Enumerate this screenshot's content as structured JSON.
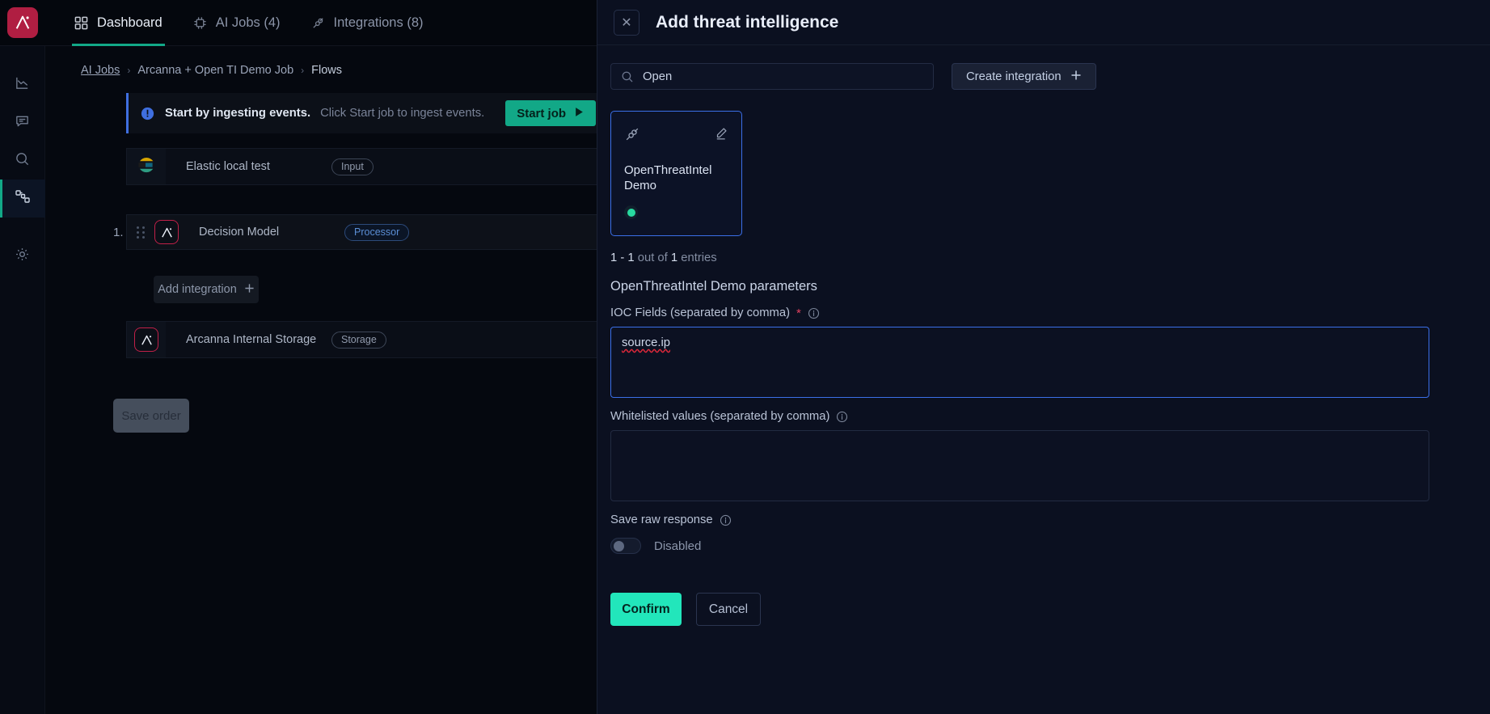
{
  "app": {
    "brand_color": "#b01e42",
    "accent_teal": "#12a887",
    "accent_cyan": "#22e6bb",
    "nav": [
      {
        "label": "Dashboard",
        "icon": "grid-icon",
        "active": true
      },
      {
        "label": "AI Jobs (4)",
        "icon": "chip-icon",
        "active": false
      },
      {
        "label": "Integrations (8)",
        "icon": "plug-icon",
        "active": false
      }
    ],
    "sidebar": [
      {
        "name": "analytics",
        "icon": "chart-line-icon",
        "active": false
      },
      {
        "name": "feedback",
        "icon": "comment-icon",
        "active": false
      },
      {
        "name": "search",
        "icon": "search-icon",
        "active": false
      },
      {
        "name": "flows",
        "icon": "nodes-icon",
        "active": true
      },
      {
        "name": "settings",
        "icon": "gear-icon",
        "active": false
      }
    ],
    "breadcrumb": {
      "first": "AI Jobs",
      "second": "Arcanna + Open TI Demo Job",
      "third": "Flows",
      "separator": "›"
    },
    "notice": {
      "icon": "info-circle-icon",
      "strong": "Start by ingesting events.",
      "sub": "Click Start job to ingest events.",
      "button": "Start job",
      "button_icon": "play-icon"
    },
    "flow": {
      "input_row": {
        "name": "Elastic local test",
        "badge": "Input",
        "icon": "elastic-icon"
      },
      "step_number": "1.",
      "processor_row": {
        "name": "Decision Model",
        "badge": "Processor",
        "icon": "arcanna-icon",
        "grip": "drag-handle-icon"
      },
      "add_integration": "Add integration",
      "add_integration_icon": "plus-icon",
      "storage_row": {
        "name": "Arcanna Internal Storage",
        "badge": "Storage",
        "icon": "arcanna-icon"
      },
      "save_order": "Save order"
    }
  },
  "drawer": {
    "title": "Add threat intelligence",
    "close_icon": "close-icon",
    "search": {
      "value": "Open",
      "placeholder": "Search",
      "icon": "search-icon"
    },
    "create_button": {
      "label": "Create integration",
      "icon": "plus-icon"
    },
    "card": {
      "title": "OpenThreatIntel Demo",
      "icon": "plug-icon",
      "edit_icon": "pencil-icon",
      "status": "online",
      "status_color": "#28d9a0",
      "selected": true
    },
    "entries": {
      "range": "1 - 1",
      "middle": "out of",
      "total": "1",
      "suffix": "entries"
    },
    "params_title": "OpenThreatIntel Demo parameters",
    "fields": [
      {
        "label": "IOC Fields (separated by comma)",
        "required": true,
        "required_marker": "*",
        "info_icon": "info-icon",
        "value": "source.ip",
        "placeholder": ""
      },
      {
        "label": "Whitelisted values (separated by comma)",
        "required": false,
        "required_marker": "",
        "info_icon": "info-icon",
        "value": "",
        "placeholder": ""
      }
    ],
    "toggle": {
      "label": "Save raw response",
      "info_icon": "info-icon",
      "state_label": "Disabled",
      "enabled": false
    },
    "confirm": "Confirm",
    "cancel": "Cancel"
  }
}
